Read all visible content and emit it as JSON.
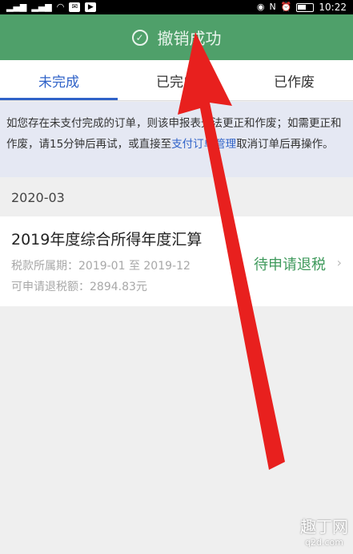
{
  "status_bar": {
    "time": "10:22",
    "left_icons": [
      "signal-icon",
      "wifi-icon",
      "message-icon",
      "app-icon"
    ],
    "right_icons": [
      "eye-icon",
      "nfc-icon",
      "alarm-icon",
      "battery-icon"
    ]
  },
  "toast": {
    "text": "撤销成功"
  },
  "tabs": [
    {
      "label": "未完成",
      "active": true
    },
    {
      "label": "已完成",
      "active": false
    },
    {
      "label": "已作废",
      "active": false
    }
  ],
  "notice": {
    "text_before": "如您存在未支付完成的订单，则该申报表无法更正和作废；如需更正和作废，请15分钟后再试，或直接至",
    "link": "支付订单管理",
    "text_after": "取消订单后再操作。"
  },
  "month": "2020-03",
  "order": {
    "title": "2019年度综合所得年度汇算",
    "period": "税款所属期：2019-01 至 2019-12",
    "refund": "可申请退税额：2894.83元",
    "status": "待申请退税"
  },
  "colors": {
    "accent": "#2f62c8",
    "toast_bg": "#4fa06a",
    "status_green": "#3f9a5c",
    "arrow_red": "#e8201e"
  },
  "watermark": {
    "big": "趣丁网",
    "small": "q2d.com"
  }
}
